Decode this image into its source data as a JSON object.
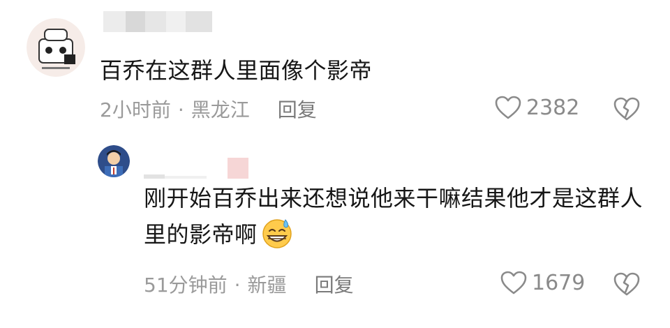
{
  "comments": [
    {
      "text": "百乔在这群人里面像个影帝",
      "time": "2小时前",
      "location": "黑龙江",
      "reply_label": "回复",
      "like_count": "2382"
    },
    {
      "text": "刚开始百乔出来还想说他来干嘛结果他才是这群人里的影帝啊",
      "time": "51分钟前",
      "location": "新疆",
      "reply_label": "回复",
      "like_count": "1679"
    }
  ],
  "separator": "·",
  "icons": {
    "like": "heart-outline-icon",
    "dislike": "broken-heart-icon",
    "emoji": "grinning-sweat-emoji"
  },
  "colors": {
    "text": "#161616",
    "meta": "#9a9a9a",
    "icon": "#8a8a8a",
    "redaction": "#e6e6e6",
    "redaction_pink": "#f6d6d6"
  }
}
